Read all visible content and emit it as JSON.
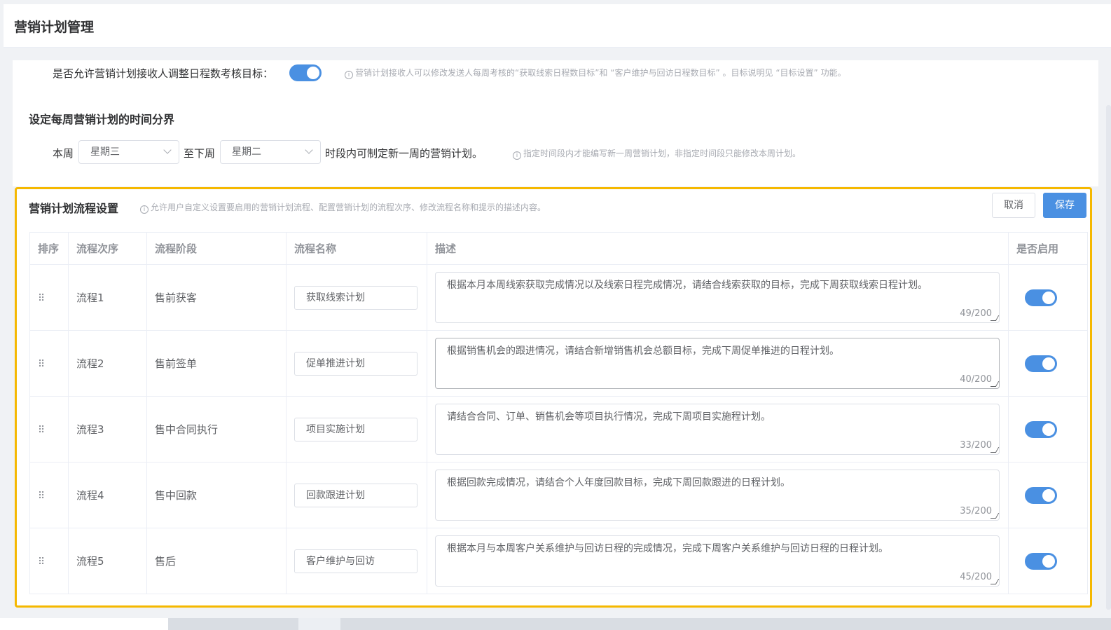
{
  "page": {
    "title": "营销计划管理"
  },
  "allow": {
    "label": "是否允许营销计划接收人调整日程数考核目标：",
    "enabled": true,
    "hint": "营销计划接收人可以修改发送人每周考核的“获取线索日程数目标”和 “客户维护与回访日程数目标” 。目标说明见 “目标设置” 功能。"
  },
  "time_section": {
    "title": "设定每周营销计划的时间分界",
    "this_week_label": "本周",
    "this_week_value": "星期三",
    "to_next_week_label": "至下周",
    "next_week_value": "星期二",
    "suffix": "时段内可制定新一周的营销计划。",
    "hint": "指定时间段内才能编写新一周营销计划，非指定时间段只能修改本周计划。"
  },
  "flow_section": {
    "title": "营销计划流程设置",
    "hint": "允许用户自定义设置要启用的营销计划流程、配置营销计划的流程次序、修改流程名称和提示的描述内容。",
    "cancel_label": "取消",
    "save_label": "保存",
    "columns": [
      "排序",
      "流程次序",
      "流程阶段",
      "流程名称",
      "描述",
      "是否启用"
    ],
    "rows": [
      {
        "order": "流程1",
        "stage": "售前获客",
        "name": "获取线索计划",
        "desc": "根据本月本周线索获取完成情况以及线索日程完成情况，请结合线索获取的目标，完成下周获取线索日程计划。",
        "count": "49/200",
        "enabled": true
      },
      {
        "order": "流程2",
        "stage": "售前签单",
        "name": "促单推进计划",
        "desc": "根据销售机会的跟进情况，请结合新增销售机会总额目标，完成下周促单推进的日程计划。",
        "count": "40/200",
        "enabled": true
      },
      {
        "order": "流程3",
        "stage": "售中合同执行",
        "name": "项目实施计划",
        "desc": "请结合合同、订单、销售机会等项目执行情况，完成下周项目实施程计划。",
        "count": "33/200",
        "enabled": true
      },
      {
        "order": "流程4",
        "stage": "售中回款",
        "name": "回款跟进计划",
        "desc": "根据回款完成情况，请结合个人年度回款目标，完成下周回款跟进的日程计划。",
        "count": "35/200",
        "enabled": true
      },
      {
        "order": "流程5",
        "stage": "售后",
        "name": "客户维护与回访",
        "desc": "根据本月与本周客户关系维护与回访日程的完成情况，完成下周客户关系维护与回访日程的日程计划。",
        "count": "45/200",
        "enabled": true
      }
    ]
  },
  "icons": {
    "info": "info-circle-icon",
    "drag": "drag-handle-icon",
    "chevron": "chevron-down-icon"
  },
  "colors": {
    "accent": "#4a90e2",
    "highlight": "#f5b800"
  }
}
